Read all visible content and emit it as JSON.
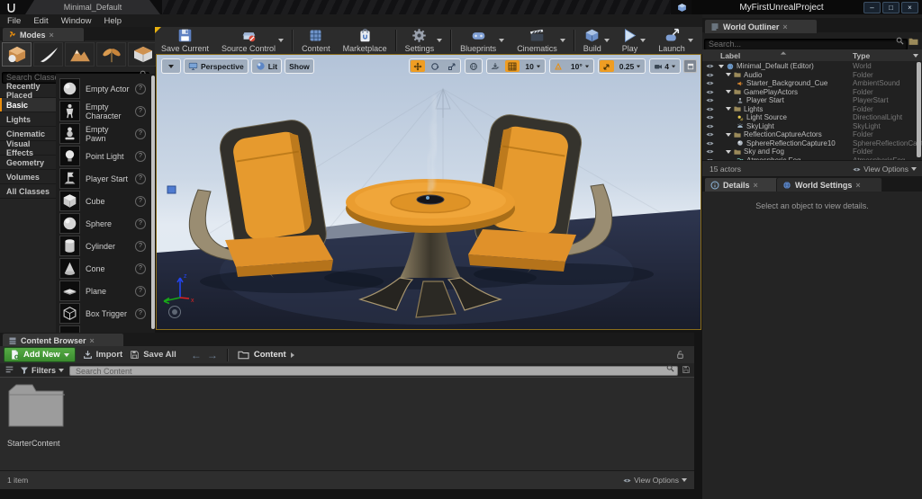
{
  "titlebar": {
    "tab": "Minimal_Default",
    "project": "MyFirstUnrealProject",
    "minimize": "–",
    "maximize": "□",
    "close": "×"
  },
  "menubar": {
    "items": [
      "File",
      "Edit",
      "Window",
      "Help"
    ]
  },
  "modes": {
    "tab": "Modes",
    "search_placeholder": "Search Classes",
    "mode_icons": [
      "place-mode-icon",
      "paint-mode-icon",
      "landscape-mode-icon",
      "foliage-mode-icon",
      "geometry-mode-icon"
    ],
    "categories": [
      "Recently Placed",
      "Basic",
      "Lights",
      "Cinematic",
      "Visual Effects",
      "Geometry",
      "Volumes",
      "All Classes"
    ],
    "selected_category": "Basic",
    "items": [
      "Empty Actor",
      "Empty Character",
      "Empty Pawn",
      "Point Light",
      "Player Start",
      "Cube",
      "Sphere",
      "Cylinder",
      "Cone",
      "Plane",
      "Box Trigger"
    ]
  },
  "toolbar": {
    "save_current": "Save Current",
    "source_control": "Source Control",
    "content": "Content",
    "marketplace": "Marketplace",
    "settings": "Settings",
    "blueprints": "Blueprints",
    "cinematics": "Cinematics",
    "build": "Build",
    "play": "Play",
    "launch": "Launch"
  },
  "viewport": {
    "perspective": "Perspective",
    "lit": "Lit",
    "show": "Show",
    "grid_snap": "10",
    "rotation_snap": "10°",
    "scale_snap": "0.25",
    "camera_speed": "4"
  },
  "outliner": {
    "tab": "World Outliner",
    "search_placeholder": "Search...",
    "col_label": "Label",
    "col_type": "Type",
    "rows": [
      {
        "label": "Minimal_Default (Editor)",
        "type": "World",
        "icon": "world-icon"
      },
      {
        "label": "Audio",
        "type": "Folder",
        "icon": "folder-icon"
      },
      {
        "label": "Starter_Background_Cue",
        "type": "AmbientSound",
        "icon": "sound-icon"
      },
      {
        "label": "GamePlayActors",
        "type": "Folder",
        "icon": "folder-icon"
      },
      {
        "label": "Player Start",
        "type": "PlayerStart",
        "icon": "player-start-icon"
      },
      {
        "label": "Lights",
        "type": "Folder",
        "icon": "folder-icon"
      },
      {
        "label": "Light Source",
        "type": "DirectionalLight",
        "icon": "directional-light-icon"
      },
      {
        "label": "SkyLight",
        "type": "SkyLight",
        "icon": "sky-light-icon"
      },
      {
        "label": "ReflectionCaptureActors",
        "type": "Folder",
        "icon": "folder-icon"
      },
      {
        "label": "SphereReflectionCapture10",
        "type": "SphereReflectionCapture",
        "icon": "reflection-capture-icon"
      },
      {
        "label": "Sky and Fog",
        "type": "Folder",
        "icon": "folder-icon"
      },
      {
        "label": "Atmospheric Fog",
        "type": "AtmosphericFog",
        "icon": "fog-icon"
      }
    ],
    "count": "15 actors",
    "view_options": "View Options"
  },
  "details": {
    "tab_details": "Details",
    "tab_world_settings": "World Settings",
    "empty": "Select an object to view details."
  },
  "content_browser": {
    "tab": "Content Browser",
    "add_new": "Add New",
    "import": "Import",
    "save_all": "Save All",
    "breadcrumb": "Content",
    "filters": "Filters",
    "search_placeholder": "Search Content",
    "folder": "StarterContent",
    "count": "1 item",
    "view_options": "View Options"
  },
  "colors": {
    "accent_orange": "#EF9D23",
    "green_button": "#3F9B3F",
    "viewport_border": "#8A6D1B",
    "table_orange": "#EA9D30",
    "floor_navy": "#232A3E"
  }
}
